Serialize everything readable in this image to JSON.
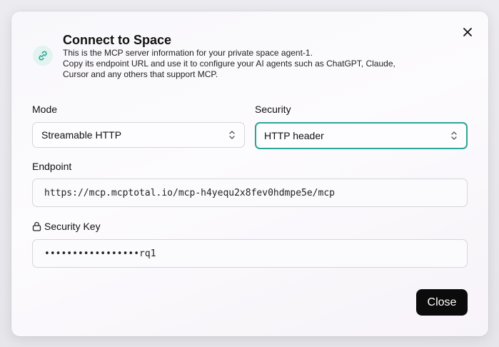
{
  "dialog": {
    "title": "Connect to Space",
    "description_lines": [
      "This is the MCP server information for your private space agent-1.",
      "Copy its endpoint URL and use it to configure your AI agents such as ChatGPT, Claude,",
      "Cursor and any others that support MCP."
    ],
    "icon": "link-icon",
    "accent_color": "#2aa698"
  },
  "mode": {
    "label": "Mode",
    "value": "Streamable HTTP"
  },
  "security": {
    "label": "Security",
    "value": "HTTP header"
  },
  "endpoint": {
    "label": "Endpoint",
    "value": "https://mcp.mcptotal.io/mcp-h4yequ2x8fev0hdmpe5e/mcp"
  },
  "security_key": {
    "label": "Security Key",
    "icon": "lock-icon",
    "value": "•••••••••••••••••rq1"
  },
  "actions": {
    "close_label": "Close",
    "close_icon": "close-icon"
  }
}
